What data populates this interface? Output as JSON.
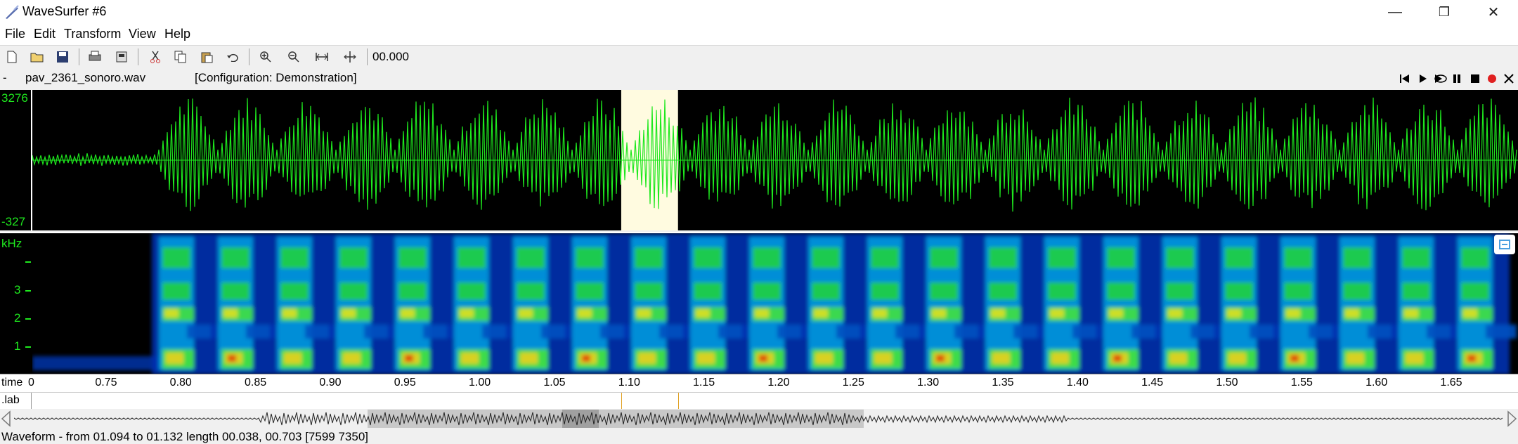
{
  "window": {
    "title": "WaveSurfer #6",
    "minimize": "—",
    "restore": "❐",
    "close": "✕"
  },
  "menu": [
    "File",
    "Edit",
    "Transform",
    "View",
    "Help"
  ],
  "toolbar": {
    "icons": [
      "new-file-icon",
      "open-folder-icon",
      "save-icon",
      "print-icon",
      "print-setup-icon",
      "cut-icon",
      "copy-icon",
      "paste-icon",
      "undo-icon",
      "zoom-in-icon",
      "zoom-out-icon",
      "zoom-selection-icon",
      "zoom-all-icon"
    ],
    "time_readout": "00.000"
  },
  "file": {
    "dash": "-",
    "filename": "pav_2361_sonoro.wav",
    "configuration": "[Configuration: Demonstration]"
  },
  "transport": [
    "skip-to-start-icon",
    "play-icon",
    "play-loop-icon",
    "pause-icon",
    "stop-icon",
    "record-icon",
    "close-pane-icon"
  ],
  "waveform": {
    "ymax_label": "3276",
    "ymin_label": "-327",
    "color": "#1ee81e",
    "selection_color": "#fffbe0"
  },
  "spectrogram": {
    "unit_label": "kHz",
    "freq_ticks": [
      "3",
      "2",
      "1"
    ]
  },
  "time_axis": {
    "name": "time",
    "first_tick": "0",
    "ticks": [
      "0.75",
      "0.80",
      "0.85",
      "0.90",
      "0.95",
      "1.00",
      "1.05",
      "1.10",
      "1.15",
      "1.20",
      "1.25",
      "1.30",
      "1.35",
      "1.40",
      "1.45",
      "1.50",
      "1.55",
      "1.60",
      "1.65"
    ]
  },
  "lab_track": {
    "name": ".lab"
  },
  "selection": {
    "start": 1.094,
    "end": 1.132
  },
  "view_range": {
    "start": 0.7,
    "end": 1.694
  },
  "status": "Waveform - from 01.094 to 01.132 length 00.038, 00.703 [7599 7350]"
}
